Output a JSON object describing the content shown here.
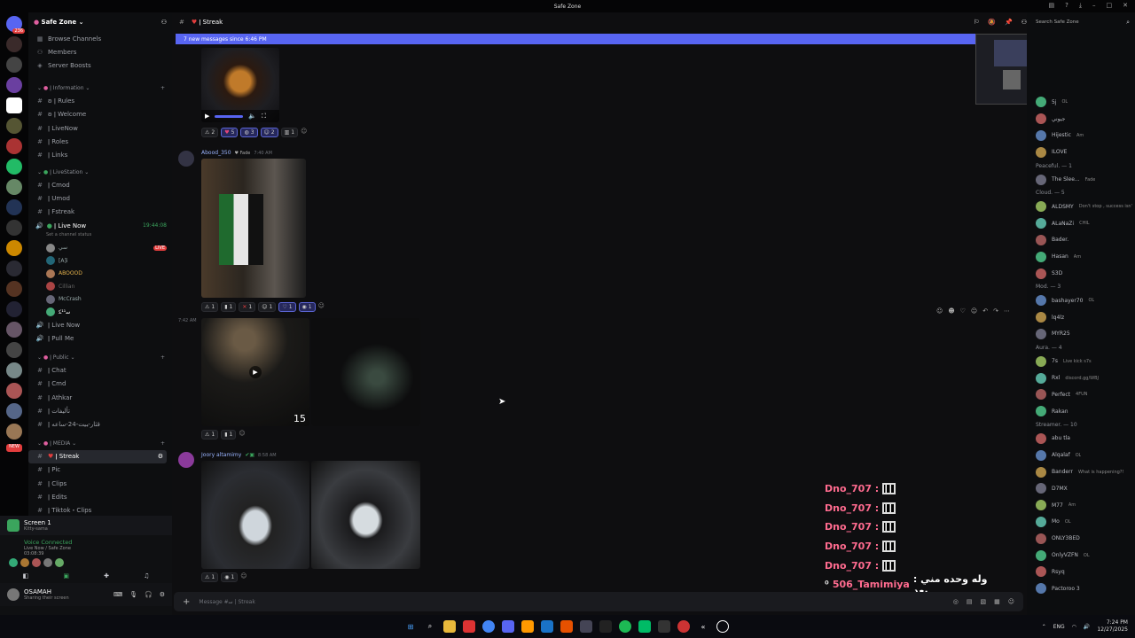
{
  "window": {
    "title": "Safe Zone"
  },
  "server": {
    "name": "Safe Zone",
    "browse": "Browse Channels",
    "members": "Members",
    "boosts": "Server Boosts"
  },
  "categories": [
    {
      "name": "Information",
      "channels": [
        "Rules",
        "Welcome",
        "LiveNow",
        "Roles",
        "Links"
      ]
    },
    {
      "name": "LiveStation",
      "channels": [
        "Cmod",
        "Umod",
        "Fstreak"
      ]
    }
  ],
  "live_now": {
    "label": "Live Now",
    "timer": "19:44:08",
    "status": "Set a channel status",
    "live_badge": "LIVE",
    "users": [
      "ﺳﻲ",
      "[A]i",
      "ABOOOD",
      "Cillian",
      "McCrash",
      "ﺳ¹¹ﻜ"
    ]
  },
  "voice_extra": [
    "Live Now",
    "Pull Me"
  ],
  "public": {
    "name": "Public",
    "channels": [
      "Chat",
      "Cmd",
      "Athkar",
      "ﺗﺄﻟﻴﻔﺎت",
      "ﻗﺜﺎﺭ-ﺒﻴﺖ-24-ﺳﺎﻋﻪ"
    ]
  },
  "media": {
    "name": "MEDIA",
    "channels": [
      "Streak",
      "Pic",
      "Clips",
      "Edits",
      "Tiktok・Clips"
    ]
  },
  "voice_panel": {
    "screen": "Screen 1",
    "sub": "Kitty-sama",
    "connected": "Voice Connected",
    "channel": "Live Now / Safe Zone",
    "time": "03:08:39",
    "user": "OSAMAH",
    "user_sub": "Sharing their screen",
    "new_badge": "NEW"
  },
  "channel": {
    "name": "Streak",
    "search": "Search Safe Zone",
    "new_messages": "7 new messages since 6:46 PM",
    "input_placeholder": "Message #ﺳ | Streak"
  },
  "messages": {
    "m0_reactions": [
      "2",
      "5",
      "3",
      "2",
      "1"
    ],
    "m1": {
      "author": "Abood_350",
      "tag": "Fade",
      "time": "7:40 AM",
      "reactions": [
        "1",
        "1",
        "1",
        "1",
        "1",
        "1"
      ]
    },
    "m2": {
      "time": "7:42 AM",
      "reactions": [
        "1",
        "1"
      ],
      "video_len": "15"
    },
    "m3": {
      "author": "Joory altamimy",
      "time": "8:58 AM",
      "reactions": [
        "1",
        "1"
      ]
    }
  },
  "overlay": {
    "lines": [
      "Dno_707 :",
      "Dno_707 :",
      "Dno_707 :",
      "Dno_707 :",
      "Dno_707 :"
    ],
    "last_name": "506_Tamimiya",
    "last_text": ": ﻭﻟﻪ ﻭﺣﺪﻩ ﻣﻨﻲ ﺑﻌﺪ"
  },
  "members_list": [
    {
      "group": "",
      "members": [
        {
          "name": "5j",
          "note": "OL"
        },
        {
          "name": "ﺟﻴﻮﻧﻲ",
          "note": ""
        },
        {
          "name": "Hijestic",
          "note": "Am"
        },
        {
          "name": "ILOVE",
          "note": ""
        }
      ]
    },
    {
      "group": "Peaceful. — 1",
      "members": [
        {
          "name": "The Slee...",
          "note": "Fade"
        }
      ]
    },
    {
      "group": "Cloud. — 5",
      "members": [
        {
          "name": "ALDSMY",
          "note": "Don't stop , success isn't that..."
        },
        {
          "name": "ALaNaZi",
          "note": "CHIL"
        },
        {
          "name": "Bader.",
          "note": ""
        },
        {
          "name": "Hasan",
          "note": "Am"
        },
        {
          "name": "S3D",
          "note": ""
        }
      ]
    },
    {
      "group": "Mod. — 3",
      "members": [
        {
          "name": "bashayer70",
          "note": "OL"
        },
        {
          "name": "lq4lz",
          "note": ""
        },
        {
          "name": "MYR25",
          "note": ""
        }
      ]
    },
    {
      "group": "Aura. — 4",
      "members": [
        {
          "name": "7s",
          "note": "Live kick s7s"
        },
        {
          "name": "Rxl",
          "note": "discord.gg/WBJ"
        },
        {
          "name": "Perfect",
          "note": "4FUN"
        },
        {
          "name": "Rakan",
          "note": ""
        }
      ]
    },
    {
      "group": "Streamer. — 10",
      "members": [
        {
          "name": "abu tla",
          "note": ""
        },
        {
          "name": "Alqalaf",
          "note": "OL"
        },
        {
          "name": "Banderr",
          "note": "What is happening?!"
        },
        {
          "name": "D7MX",
          "note": ""
        },
        {
          "name": "M77",
          "note": "Am"
        },
        {
          "name": "Mo",
          "note": "OL"
        },
        {
          "name": "ONLY3BED",
          "note": ""
        },
        {
          "name": "OnlyVZFN",
          "note": "OL"
        },
        {
          "name": "Rsyq",
          "note": ""
        },
        {
          "name": "Pactoroo 3",
          "note": ""
        }
      ]
    }
  ],
  "taskbar": {
    "lang": "ENG",
    "time": "7:24 PM",
    "date": "12/27/2025"
  }
}
